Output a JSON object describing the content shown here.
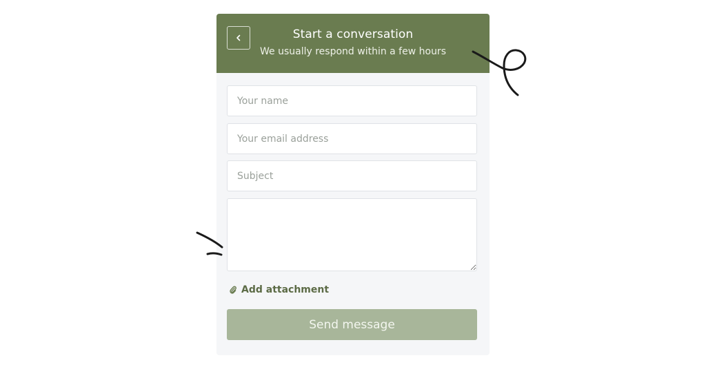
{
  "header": {
    "title": "Start a conversation",
    "subtitle": "We usually respond within a few hours",
    "back_icon": "chevron-left-icon",
    "background_color": "#6a7c50"
  },
  "form": {
    "name_placeholder": "Your name",
    "email_placeholder": "Your email address",
    "subject_placeholder": "Subject",
    "message_placeholder": "",
    "name_value": "",
    "email_value": "",
    "subject_value": "",
    "message_value": ""
  },
  "attachment": {
    "label": "Add attachment",
    "icon": "paperclip-icon"
  },
  "send_button": {
    "label": "Send message",
    "state": "disabled",
    "color": "#a8b69a"
  }
}
